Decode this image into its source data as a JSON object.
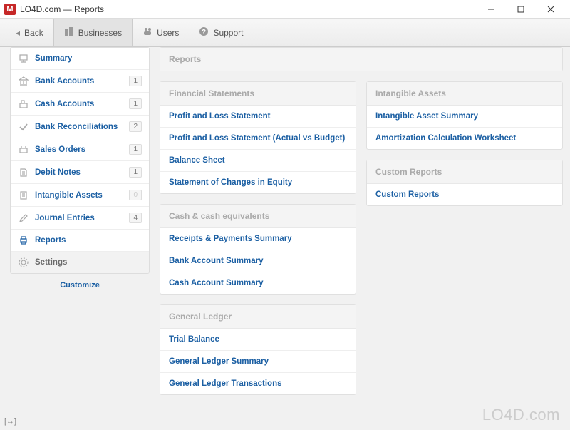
{
  "window": {
    "title": "LO4D.com — Reports",
    "app_initial": "M"
  },
  "toolbar": {
    "back": "Back",
    "businesses": "Businesses",
    "users": "Users",
    "support": "Support"
  },
  "sidebar": {
    "items": [
      {
        "label": "Summary",
        "badge": ""
      },
      {
        "label": "Bank Accounts",
        "badge": "1"
      },
      {
        "label": "Cash Accounts",
        "badge": "1"
      },
      {
        "label": "Bank Reconciliations",
        "badge": "2"
      },
      {
        "label": "Sales Orders",
        "badge": "1"
      },
      {
        "label": "Debit Notes",
        "badge": "1"
      },
      {
        "label": "Intangible Assets",
        "badge": "0"
      },
      {
        "label": "Journal Entries",
        "badge": "4"
      },
      {
        "label": "Reports",
        "badge": ""
      },
      {
        "label": "Settings",
        "badge": ""
      }
    ],
    "customize": "Customize"
  },
  "main": {
    "reports_header": "Reports",
    "sections": {
      "fin": {
        "title": "Financial Statements",
        "items": [
          "Profit and Loss Statement",
          "Profit and Loss Statement (Actual vs Budget)",
          "Balance Sheet",
          "Statement of Changes in Equity"
        ]
      },
      "cash": {
        "title": "Cash & cash equivalents",
        "items": [
          "Receipts & Payments Summary",
          "Bank Account Summary",
          "Cash Account Summary"
        ]
      },
      "gl": {
        "title": "General Ledger",
        "items": [
          "Trial Balance",
          "General Ledger Summary",
          "General Ledger Transactions"
        ]
      },
      "intangible": {
        "title": "Intangible Assets",
        "items": [
          "Intangible Asset Summary",
          "Amortization Calculation Worksheet"
        ]
      },
      "custom": {
        "title": "Custom Reports",
        "items": [
          "Custom Reports"
        ]
      }
    }
  },
  "watermark": "LO4D.com"
}
